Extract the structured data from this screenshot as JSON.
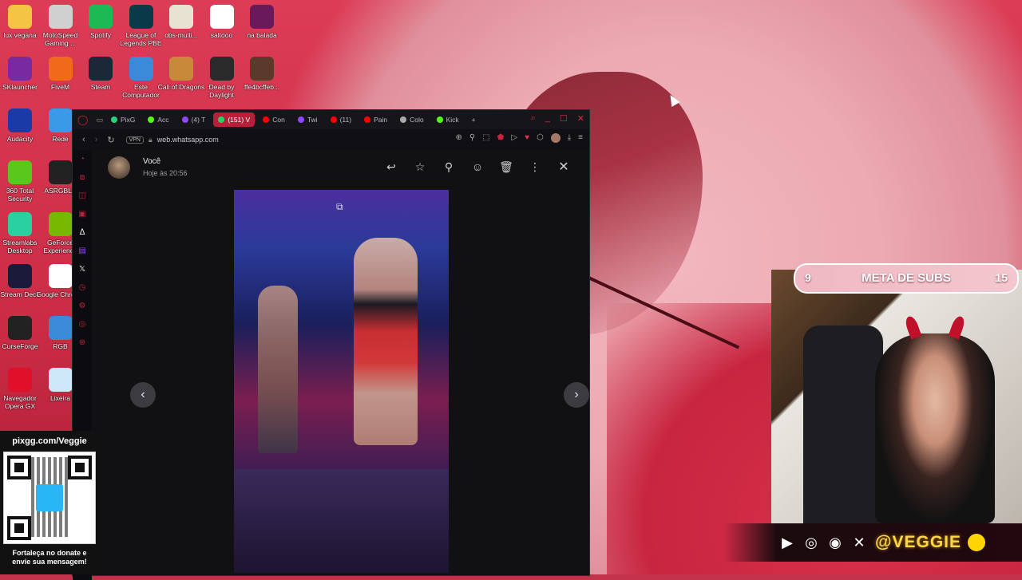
{
  "desktop": {
    "icons": [
      {
        "label": "lux vegana",
        "icon": "folder-icon",
        "color": "#f4c542"
      },
      {
        "label": "MotoSpeed Gaming ...",
        "icon": "motospeed-icon",
        "color": "#d0d0d0"
      },
      {
        "label": "Spotify",
        "icon": "spotify-icon",
        "color": "#1db954"
      },
      {
        "label": "League of Legends PBE",
        "icon": "league-icon",
        "color": "#0a3a4a"
      },
      {
        "label": "obs-multi...",
        "icon": "document-icon",
        "color": "#e8e2d2"
      },
      {
        "label": "saltooo",
        "icon": "chrome-icon",
        "color": "#ffffff"
      },
      {
        "label": "na balada",
        "icon": "image-icon",
        "color": "#6a1a5a"
      },
      {
        "label": "SKlauncher",
        "icon": "sklauncher-icon",
        "color": "#7a2aa0"
      },
      {
        "label": "FiveM",
        "icon": "fivem-icon",
        "color": "#f06a1a"
      },
      {
        "label": "Steam",
        "icon": "steam-icon",
        "color": "#1b2838"
      },
      {
        "label": "Este Computador",
        "icon": "computer-icon",
        "color": "#3a8ad8"
      },
      {
        "label": "Call of Dragons",
        "icon": "call-of-dragons-icon",
        "color": "#c88a3a"
      },
      {
        "label": "Dead by Daylight",
        "icon": "dead-by-daylight-icon",
        "color": "#2a2a2a"
      },
      {
        "label": "ffe4bcffeb...",
        "icon": "image-icon",
        "color": "#5a3a2a"
      },
      {
        "label": "Audacity",
        "icon": "audacity-icon",
        "color": "#1a3aa8"
      },
      {
        "label": "Rede",
        "icon": "network-icon",
        "color": "#3a9ae8"
      },
      {
        "label": "360 Total Security",
        "icon": "shield-icon",
        "color": "#5ac81a"
      },
      {
        "label": "ASRGBLE",
        "icon": "asrock-icon",
        "color": "#222222"
      },
      {
        "label": "Streamlabs Desktop",
        "icon": "streamlabs-icon",
        "color": "#2ad0a0"
      },
      {
        "label": "GeForce Experience",
        "icon": "nvidia-icon",
        "color": "#76b900"
      },
      {
        "label": "Stream Deck",
        "icon": "stream-deck-icon",
        "color": "#1a1a3a"
      },
      {
        "label": "Google Chrome",
        "icon": "chrome-icon",
        "color": "#ffffff"
      },
      {
        "label": "CurseForge",
        "icon": "curseforge-icon",
        "color": "#222222"
      },
      {
        "label": "RGB",
        "icon": "rgb-icon",
        "color": "#3a8ad8"
      },
      {
        "label": "Navegador Opera GX",
        "icon": "opera-gx-icon",
        "color": "#e0102a"
      },
      {
        "label": "Lixeira",
        "icon": "recycle-bin-icon",
        "color": "#cfe8f8"
      }
    ]
  },
  "browser": {
    "tabs": [
      {
        "label": "PixG",
        "color": "#2ad07a"
      },
      {
        "label": "Acc",
        "color": "#53fc18"
      },
      {
        "label": "(4) T",
        "color": "#9146ff"
      },
      {
        "label": "(151) V",
        "color": "#25d366",
        "active": true
      },
      {
        "label": "Con",
        "color": "#ff0000"
      },
      {
        "label": "Twi",
        "color": "#9146ff"
      },
      {
        "label": "(11)",
        "color": "#ff0000"
      },
      {
        "label": "Pain",
        "color": "#ff0000"
      },
      {
        "label": "Colo",
        "color": "#aaaaaa"
      },
      {
        "label": "Kick",
        "color": "#53fc18"
      }
    ],
    "new_tab": "+",
    "address": {
      "vpn": "VPN",
      "url": "web.whatsapp.com"
    }
  },
  "viewer": {
    "sender": "Você",
    "timestamp": "Hoje às 20:56",
    "actions": [
      "reply-icon",
      "star-icon",
      "pin-icon",
      "emoji-icon",
      "delete-icon",
      "more-icon",
      "close-icon"
    ]
  },
  "pix": {
    "url": "pixgg.com/Veggie",
    "message_line1": "Fortaleça no donate e",
    "message_line2": "envie sua mensagem!"
  },
  "subs_goal": {
    "current": "9",
    "label": "META DE SUBS",
    "target": "15"
  },
  "socials": {
    "handle": "@VEGGIE",
    "icons": [
      "youtube-icon",
      "instagram-icon",
      "spotify-icon",
      "x-icon"
    ]
  },
  "colors": {
    "accent": "#b81f3a",
    "whatsapp": "#25d366",
    "handle": "#ffd54a"
  }
}
